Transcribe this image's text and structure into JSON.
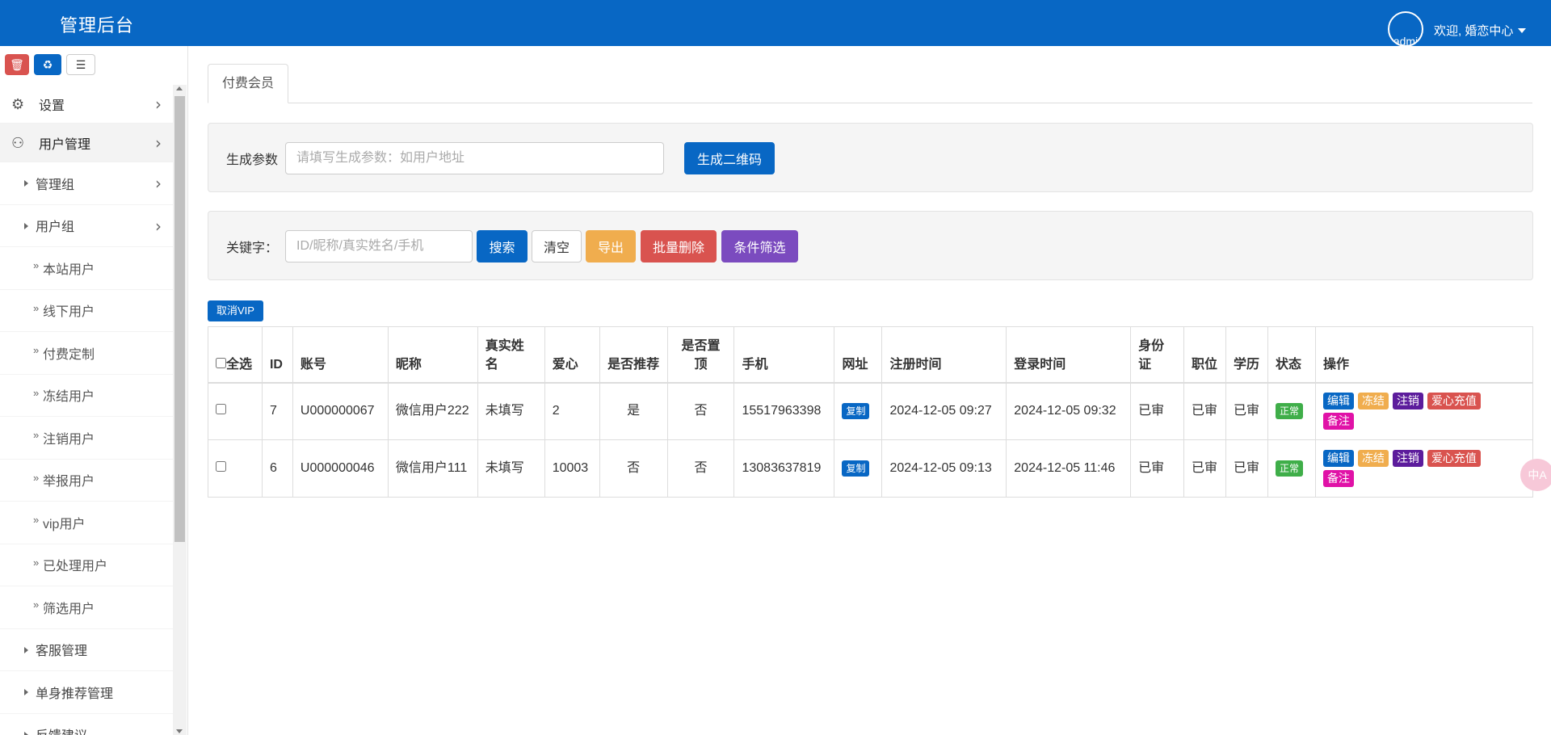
{
  "header": {
    "title": "管理后台",
    "avatar_alt": "admi",
    "welcome": "欢迎, 婚恋中心"
  },
  "sidebar": {
    "toolbar": [
      {
        "name": "trash-icon",
        "glyph": "🗑"
      },
      {
        "name": "recycle-icon",
        "glyph": "♻"
      },
      {
        "name": "list-icon",
        "glyph": "☰"
      }
    ],
    "items": [
      {
        "label": "设置",
        "icon": "gears-icon"
      },
      {
        "label": "用户管理",
        "icon": "users-icon"
      }
    ],
    "groups": [
      {
        "label": "管理组"
      },
      {
        "label": "用户组"
      }
    ],
    "leaves": [
      "本站用户",
      "线下用户",
      "付费定制",
      "冻结用户",
      "注销用户",
      "举报用户",
      "vip用户",
      "已处理用户",
      "筛选用户"
    ],
    "more": [
      {
        "label": "客服管理"
      },
      {
        "label": "单身推荐管理"
      },
      {
        "label": "反馈建议"
      }
    ]
  },
  "tabs": [
    {
      "label": "付费会员"
    }
  ],
  "generate": {
    "label": "生成参数",
    "placeholder": "请填写生成参数：如用户地址",
    "button": "生成二维码"
  },
  "search": {
    "label": "关键字：",
    "placeholder": "ID/昵称/真实姓名/手机",
    "buttons": {
      "search": "搜索",
      "clear": "清空",
      "export": "导出",
      "batch_delete": "批量删除",
      "filter": "条件筛选"
    }
  },
  "vip_button": "取消VIP",
  "table": {
    "headers": {
      "select_all": "全选",
      "id": "ID",
      "account": "账号",
      "nickname": "昵称",
      "realname": "真实姓名",
      "love": "爱心",
      "recommend": "是否推荐",
      "top": "是否置顶",
      "phone": "手机",
      "url": "网址",
      "reg_time": "注册时间",
      "login_time": "登录时间",
      "idcard": "身份证",
      "job": "职位",
      "edu": "学历",
      "status": "状态",
      "ops": "操作"
    },
    "rows": [
      {
        "id": "7",
        "account": "U000000067",
        "nickname": "微信用户222",
        "realname": "未填写",
        "love": "2",
        "recommend": "是",
        "top": "否",
        "phone": "15517963398",
        "url_btn": "复制",
        "reg_time": "2024-12-05 09:27",
        "login_time": "2024-12-05 09:32",
        "idcard": "已审",
        "job": "已审",
        "edu": "已审",
        "status": "正常"
      },
      {
        "id": "6",
        "account": "U000000046",
        "nickname": "微信用户111",
        "realname": "未填写",
        "love": "10003",
        "recommend": "否",
        "top": "否",
        "phone": "13083637819",
        "url_btn": "复制",
        "reg_time": "2024-12-05 09:13",
        "login_time": "2024-12-05 11:46",
        "idcard": "已审",
        "job": "已审",
        "edu": "已审",
        "status": "正常"
      }
    ],
    "ops": [
      "编辑",
      "冻结",
      "注销",
      "爱心充值",
      "备注"
    ]
  },
  "float_bubble": "中A"
}
